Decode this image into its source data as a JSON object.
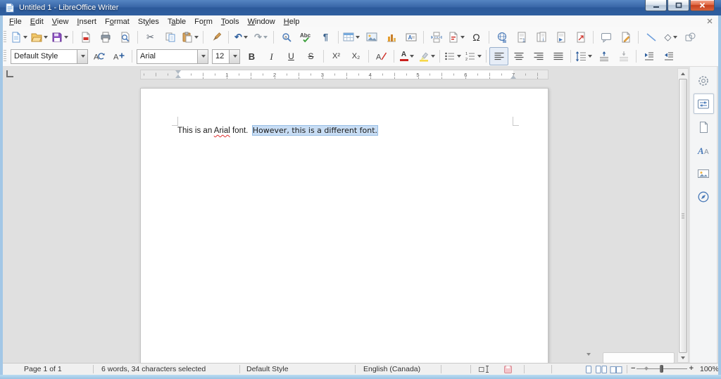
{
  "window": {
    "title": "Untitled 1 - LibreOffice Writer"
  },
  "menu": {
    "items": [
      {
        "label": "File",
        "u": 0
      },
      {
        "label": "Edit",
        "u": 0
      },
      {
        "label": "View",
        "u": 0
      },
      {
        "label": "Insert",
        "u": 0
      },
      {
        "label": "Format",
        "u": 1
      },
      {
        "label": "Styles",
        "u": 2
      },
      {
        "label": "Table",
        "u": 1
      },
      {
        "label": "Form",
        "u": 2
      },
      {
        "label": "Tools",
        "u": 0
      },
      {
        "label": "Window",
        "u": 0
      },
      {
        "label": "Help",
        "u": 0
      }
    ]
  },
  "toolbars": {
    "standard": [
      "new-document",
      "open",
      "save",
      "export-pdf",
      "print",
      "print-preview",
      "cut",
      "copy",
      "paste",
      "clone-formatting",
      "undo",
      "redo",
      "find-replace",
      "spelling",
      "formatting-marks",
      "insert-table",
      "insert-image",
      "insert-chart",
      "insert-text-box",
      "insert-page-break",
      "insert-field",
      "insert-special-character",
      "insert-hyperlink",
      "insert-footnote",
      "insert-endnote",
      "insert-bookmark",
      "insert-cross-reference",
      "insert-comment",
      "track-changes",
      "insert-line",
      "basic-shapes",
      "draw-functions"
    ],
    "formatting": [
      "paragraph-style",
      "update-style",
      "new-style",
      "font-name",
      "font-size",
      "bold",
      "italic",
      "underline",
      "strikethrough",
      "superscript",
      "subscript",
      "clear-formatting",
      "font-color",
      "highlight-color",
      "unordered-list",
      "ordered-list",
      "align-left",
      "align-center",
      "align-right",
      "justify",
      "line-spacing",
      "increase-paragraph-spacing",
      "decrease-paragraph-spacing",
      "increase-indent",
      "decrease-indent"
    ]
  },
  "formatting": {
    "paragraph_style": "Default Style",
    "font_name": "Arial",
    "font_size": "12"
  },
  "icons": {
    "cut": "✂",
    "undo": "↶",
    "redo": "↷",
    "formatting_marks": "¶",
    "special_character": "Ω",
    "basic_shapes": "◇",
    "bold": "B",
    "italic": "I",
    "underline": "U",
    "strikethrough": "S",
    "superscript": "X²",
    "subscript": "X₂"
  },
  "ruler": {
    "numbers": [
      "1",
      "2",
      "3",
      "4",
      "5",
      "6",
      "7"
    ]
  },
  "document": {
    "segments": [
      {
        "text": "This is an ",
        "style": "plain"
      },
      {
        "text": "Arial",
        "style": "misspelled"
      },
      {
        "text": " font.  ",
        "style": "plain"
      },
      {
        "text": "However, this is a different font.",
        "style": "selected"
      }
    ]
  },
  "sidebar": {
    "tabs": [
      "sidebar-settings",
      "properties",
      "page",
      "styles",
      "gallery",
      "navigator"
    ],
    "selected": "properties"
  },
  "statusbar": {
    "page_info": "Page 1 of 1",
    "word_count": "6 words, 34 characters selected",
    "paragraph_style": "Default Style",
    "language": "English (Canada)",
    "zoom_level": "100%"
  }
}
